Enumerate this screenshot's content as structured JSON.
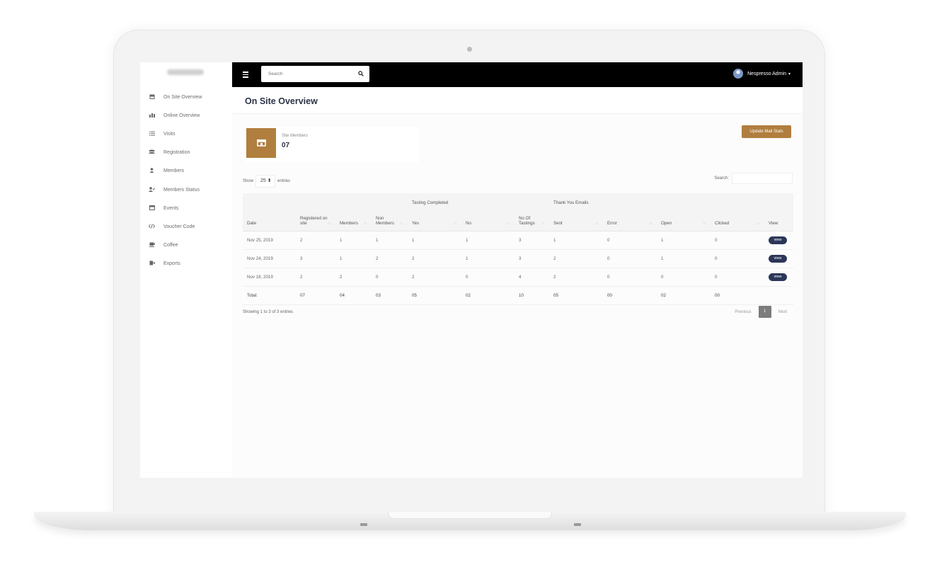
{
  "sidebar": {
    "items": [
      {
        "label": "On Site Overview",
        "icon": "store-icon"
      },
      {
        "label": "Online Overview",
        "icon": "chart-icon"
      },
      {
        "label": "Visits",
        "icon": "list-icon"
      },
      {
        "label": "Registration",
        "icon": "users-icon"
      },
      {
        "label": "Members",
        "icon": "user-icon"
      },
      {
        "label": "Members Status",
        "icon": "user-check-icon"
      },
      {
        "label": "Events",
        "icon": "calendar-icon"
      },
      {
        "label": "Voucher Code",
        "icon": "code-icon"
      },
      {
        "label": "Coffee",
        "icon": "coffee-icon"
      },
      {
        "label": "Exports",
        "icon": "export-icon"
      }
    ]
  },
  "topbar": {
    "search_placeholder": "Search",
    "user_name": "Nespresso Admin",
    "caret": "▾"
  },
  "page": {
    "title": "On Site Overview",
    "update_button": "Update Mail Stats"
  },
  "card": {
    "label": "Site Members",
    "value": "07"
  },
  "table_controls": {
    "show_label": "Show",
    "length_value": "25 ⬍",
    "entries_label": "entries",
    "search_label": "Search:"
  },
  "table": {
    "group_headers": {
      "tasting": "Tasting Completed",
      "thankyou": "Thank You Emails"
    },
    "columns": [
      "Date",
      "Registered on site",
      "Members",
      "Non Members",
      "Yes",
      "No",
      "No Of Tastings",
      "Sent",
      "Error",
      "Open",
      "Clicked",
      "View"
    ],
    "rows": [
      [
        "Nov 25, 2019",
        "2",
        "1",
        "1",
        "1",
        "1",
        "3",
        "1",
        "0",
        "1",
        "0",
        "view"
      ],
      [
        "Nov 24, 2019",
        "3",
        "1",
        "2",
        "2",
        "1",
        "3",
        "2",
        "0",
        "1",
        "0",
        "view"
      ],
      [
        "Nov 18, 2019",
        "2",
        "2",
        "0",
        "2",
        "0",
        "4",
        "2",
        "0",
        "0",
        "0",
        "view"
      ]
    ],
    "total": [
      "Total:",
      "07",
      "04",
      "03",
      "05",
      "02",
      "10",
      "05",
      "00",
      "02",
      "00",
      ""
    ]
  },
  "footer": {
    "info": "Showing 1 to 3 of 3 entries",
    "previous": "Previous",
    "current_page": "1",
    "next": "Next"
  },
  "colors": {
    "accent": "#b07e3e",
    "topbar": "#000000",
    "view_button": "#2c3658"
  }
}
